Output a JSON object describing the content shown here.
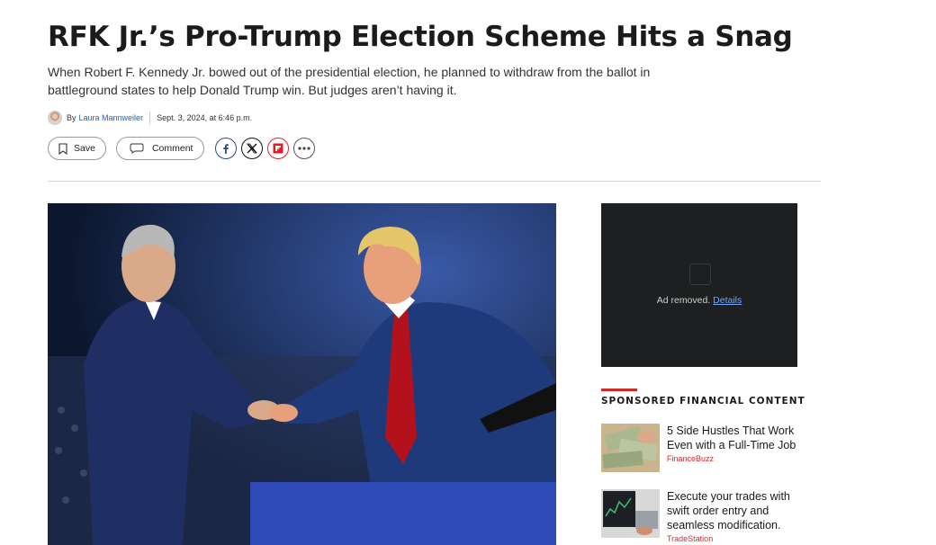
{
  "article": {
    "headline": "RFK Jr.’s Pro-Trump Election Scheme Hits a Snag",
    "dek": "When Robert F. Kennedy Jr. bowed out of the presidential election, he planned to withdraw from the ballot in battleground states to help Donald Trump win. But judges aren’t having it.",
    "byline_prefix": "By",
    "author": "Laura Mannweiler",
    "timestamp": "Sept. 3, 2024, at 6:46 p.m."
  },
  "actions": {
    "save_label": "Save",
    "comment_label": "Comment",
    "share_icons": [
      "facebook-icon",
      "x-icon",
      "flipboard-icon",
      "more-icon"
    ]
  },
  "ad": {
    "removed_text": "Ad removed.",
    "details_link": "Details"
  },
  "sponsored": {
    "heading": "SPONSORED FINANCIAL CONTENT",
    "accent_color": "#d02a2a",
    "items": [
      {
        "title": "5 Side Hustles That Work Even with a Full-Time Job",
        "source": "FinanceBuzz"
      },
      {
        "title": "Execute your trades with swift order entry and seamless modification.",
        "source": "TradeStation"
      }
    ]
  }
}
